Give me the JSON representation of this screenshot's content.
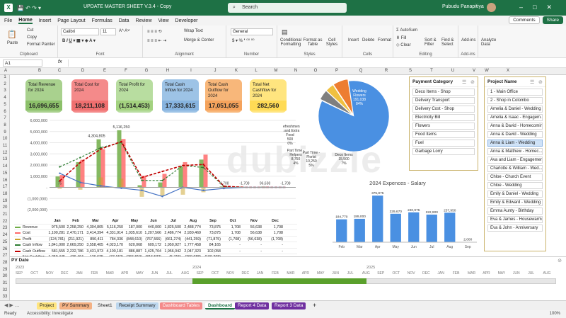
{
  "window": {
    "title": "UPDATE MASTER SHEET V.3.4 - Copy",
    "search": "Search",
    "user": "Pubudu Panapitiya",
    "app_letter": "X"
  },
  "menu": {
    "items": [
      "File",
      "Home",
      "Insert",
      "Page Layout",
      "Formulas",
      "Data",
      "Review",
      "View",
      "Developer"
    ],
    "active": "Home",
    "comments": "Comments",
    "share": "Share"
  },
  "ribbon": {
    "paste": "Paste",
    "cut": "Cut",
    "copy": "Copy",
    "format_painter": "Format Painter",
    "clipboard": "Clipboard",
    "font_name": "Calibri",
    "font_size": "11",
    "font": "Font",
    "wrap": "Wrap Text",
    "merge": "Merge & Center",
    "alignment": "Alignment",
    "number_format": "General",
    "number": "Number",
    "cond": "Conditional Formatting",
    "fmt_table": "Format as Table",
    "cell_styles": "Cell Styles",
    "styles": "Styles",
    "insert": "Insert",
    "delete": "Delete",
    "format": "Format",
    "cells": "Cells",
    "autosum": "AutoSum",
    "fill": "Fill",
    "clear": "Clear",
    "sort": "Sort & Filter",
    "find": "Find & Select",
    "editing": "Editing",
    "addins": "Add-ins",
    "addins_g": "Add-ins",
    "analyze": "Analyze Data"
  },
  "formula": {
    "cell": "A1",
    "fx": "fx"
  },
  "columns": [
    "A",
    "B",
    "C",
    "D",
    "E",
    "F",
    "G",
    "H",
    "I",
    "J",
    "K",
    "L",
    "M",
    "N",
    "O",
    "P",
    "Q",
    "R",
    "S",
    "T",
    "U",
    "V",
    "W",
    "X"
  ],
  "rows": [
    "1",
    "2",
    "3",
    "4",
    "5",
    "6",
    "7",
    "8",
    "9",
    "10",
    "11",
    "12",
    "13",
    "14",
    "15",
    "16",
    "17",
    "18",
    "19",
    "20",
    "21",
    "22",
    "23",
    "24",
    "25",
    "26",
    "27",
    "28",
    "29",
    "30",
    "31",
    "32",
    "33",
    "34"
  ],
  "cards": [
    {
      "title": "Total Revenue for 2024",
      "value": "16,696,655",
      "color": "#a9d18e",
      "vcolor": "#8cc06a"
    },
    {
      "title": "Total Cost for 2024",
      "value": "18,211,108",
      "color": "#f48a8a",
      "vcolor": "#ef6f6f"
    },
    {
      "title": "Total Profit for 2024",
      "value": "(1,514,453)",
      "color": "#b8dda0",
      "vcolor": "#a3d27f"
    },
    {
      "title": "Total Cash Inflow for 2024",
      "value": "17,333,615",
      "color": "#9dc3e6",
      "vcolor": "#86b3df"
    },
    {
      "title": "Total Cash Outflow for 2024",
      "value": "17,051,055",
      "color": "#f8b77a",
      "vcolor": "#f5a35c"
    },
    {
      "title": "Total Net Cashflow for 2024",
      "value": "282,560",
      "color": "#ffe57f",
      "vcolor": "#ffdb55"
    }
  ],
  "payment_slicer": {
    "title": "Payment Category",
    "items": [
      "Deco Items - Shop",
      "Delivery Transport",
      "Delivery Cost - Shop",
      "Electricity Bill",
      "Flowers",
      "Food Items",
      "Fuel",
      "Garbage Lorry"
    ]
  },
  "project_slicer": {
    "title": "Project Name",
    "items": [
      "1 - Main Office",
      "2 - Shop in Colombo",
      "Amelia & Daniel - Wedding",
      "Amelia & Isaac - Engagem...",
      "Anna & David - Homecoming",
      "Anna & David - Wedding",
      "Anna & Liam - Wedding",
      "Anna & Matthew - Homec...",
      "Ava and Liam - Engagement",
      "Charlotte & William - Wed...",
      "Chloe - Church Event",
      "Chloe - Wedding",
      "Emily & Daniel - Wedding",
      "Emily & Edward - Wedding",
      "Emma Aunty - Birthday",
      "Eva & James - Housewarm...",
      "Eva & John - Anniversary"
    ],
    "selected": "Anna & Liam - Wedding"
  },
  "chart_data": [
    {
      "type": "bar",
      "categories": [
        "Jan",
        "Feb",
        "Mar",
        "Apr",
        "May",
        "Jun",
        "Jul",
        "Aug",
        "Sep",
        "Oct",
        "Nov",
        "Dec"
      ],
      "series": [
        {
          "name": "Revenue",
          "values": [
            975500,
            2258250,
            4304805,
            5116250,
            187000,
            440000,
            1825500,
            2488774,
            73875,
            1708,
            56638,
            1708
          ],
          "color": "#70ad47"
        },
        {
          "name": "Cost",
          "values": [
            1100281,
            2470171,
            3414394,
            4331914,
            1035610,
            1207566,
            2256962,
            2930469,
            73875,
            1708,
            56638,
            1708
          ],
          "color": "#ff6b6b"
        },
        {
          "name": "Profit",
          "values": [
            -124781,
            -211921,
            890411,
            784336,
            -848610,
            -767566,
            -661274,
            -441259,
            -71875,
            -1708,
            -56638,
            -1708
          ],
          "color": "#c9a227"
        },
        {
          "name": "Cash Inflow",
          "values": [
            1841000,
            2669250,
            3558405,
            4023170,
            620068,
            609172,
            1950927,
            1777458,
            84165,
            0,
            0,
            0
          ],
          "color": "#2e7d32"
        },
        {
          "name": "Cash Outflow",
          "values": [
            581555,
            2232786,
            3431973,
            4100181,
            886887,
            1425704,
            1956042,
            2047323,
            102058,
            0,
            0,
            0
          ],
          "color": "#c00000"
        },
        {
          "name": "Net Cashflow",
          "values": [
            1259445,
            436464,
            126625,
            -77152,
            -266819,
            -816532,
            -5715,
            -269688,
            -100268,
            0,
            0,
            0
          ],
          "color": "#4472c4"
        }
      ],
      "ylim": [
        -2000000,
        6000000
      ],
      "yticks": [
        "6,000,000",
        "5,000,000",
        "4,000,000",
        "3,000,000",
        "2,000,000",
        "1,000,000",
        "-",
        "(1,000,000)",
        "(2,000,000)"
      ],
      "labels_peak": [
        "4,304,805",
        "5,116,250"
      ],
      "labels_small": [
        "75",
        "-1,708",
        "-1,708",
        "96,638",
        "-1,708"
      ],
      "table": [
        {
          "name": "Revenue",
          "cells": [
            "975,500",
            "2,258,250",
            "4,304,805",
            "5,116,250",
            "187,000",
            "440,000",
            "1,825,500",
            "2,488,774",
            "73,875",
            "1,708",
            "56,638",
            "1,708"
          ]
        },
        {
          "name": "Cost",
          "cells": [
            "1,100,281",
            "2,470,171",
            "3,414,394",
            "4,331,914",
            "1,035,610",
            "1,207,566",
            "2,486,774",
            "2,930,469",
            "73,875",
            "1,708",
            "56,638",
            "1,708"
          ]
        },
        {
          "name": "Profit",
          "cells": [
            "(124,781)",
            "(211,921)",
            "890,411",
            "784,336",
            "(848,610)",
            "(767,566)",
            "(661,274)",
            "(441,259)",
            "(71,875)",
            "(1,708)",
            "(56,638)",
            "(1,708)"
          ]
        },
        {
          "name": "Cash Inflow",
          "cells": [
            "1,841,000",
            "2,669,250",
            "3,558,405",
            "4,023,170",
            "620,068",
            "609,172",
            "1,950,927",
            "1,777,458",
            "84,165",
            "-",
            "-",
            "-"
          ]
        },
        {
          "name": "Cash Outflow",
          "cells": [
            "581,555",
            "2,232,786",
            "3,431,973",
            "4,100,181",
            "886,887",
            "1,425,704",
            "1,956,042",
            "2,047,323",
            "102,058",
            "-",
            "-",
            "-"
          ]
        },
        {
          "name": "Net Cashflow",
          "cells": [
            "1,259,445",
            "436,464",
            "126,625",
            "(77,152)",
            "(266,819)",
            "(816,532)",
            "(5,715)",
            "(269,688)",
            "(100,268)",
            "-",
            "-",
            "-"
          ]
        }
      ]
    },
    {
      "type": "pie",
      "slices": [
        {
          "name": "Wedding Flowers",
          "label": "Wedding Flowers",
          "value": 191038,
          "pct": "84%",
          "vtxt": "191,038",
          "color": "#4a90e2"
        },
        {
          "name": "Refreshments and Extra Food",
          "label": "Refreshmen ts and Extra Food",
          "value": 500,
          "pct": "0%",
          "vtxt": "500",
          "color": "#a9c7e8"
        },
        {
          "name": "Part Time - Florist",
          "label": "Part Time - Florist",
          "value": 10250,
          "pct": "5%",
          "vtxt": "10,250",
          "color": "#7f7f7f"
        },
        {
          "name": "Part Time - Helpers",
          "label": "Part Time - Helpers",
          "value": 8750,
          "pct": "4%",
          "vtxt": "8,750",
          "color": "#f0c040"
        },
        {
          "name": "Deco Items",
          "label": "Deco Items",
          "value": 15500,
          "pct": "7%",
          "vtxt": "15,500",
          "color": "#ed7d31"
        }
      ]
    },
    {
      "type": "bar",
      "title": "2024 Expences - Salary",
      "categories": [
        "Feb",
        "Mar",
        "Apr",
        "May",
        "Jun",
        "Jul",
        "Aug",
        "Sep"
      ],
      "values": [
        184770,
        189000,
        375875,
        229670,
        240975,
        222900,
        237950,
        2000
      ],
      "value_labels": [
        "184,770",
        "189,000",
        "375,875",
        "229,670",
        "240,975",
        "222,900",
        "237,950",
        "2,000"
      ],
      "color": "#4a90e2"
    }
  ],
  "timeline": {
    "title": "PV Date",
    "year_left": "2023",
    "year_mid": "2024",
    "year_right": "2025",
    "months": [
      "SEP",
      "OCT",
      "NOV",
      "DEC",
      "JAN",
      "FEB",
      "MAR",
      "APR",
      "MAY",
      "JUN",
      "JUL",
      "AUG",
      "SEP",
      "OCT",
      "NOV",
      "DEC",
      "JAN",
      "FEB",
      "MAR",
      "APR",
      "MAY",
      "JUN",
      "JUL",
      "AUG",
      "SEP",
      "OCT",
      "NOV",
      "DEC",
      "JAN",
      "FEB",
      "MAR",
      "APR",
      "MAY",
      "JUN",
      "JUL",
      "AUG"
    ]
  },
  "tabs": [
    {
      "name": "Project",
      "bg": "#ffe57f",
      "fg": "#222"
    },
    {
      "name": "PV Summary",
      "bg": "#f4b183",
      "fg": "#222"
    },
    {
      "name": "Sheet1",
      "bg": "#f0f0f0",
      "fg": "#222"
    },
    {
      "name": "Receipt Summary",
      "bg": "#bdd7ee",
      "fg": "#222"
    },
    {
      "name": "Dashboard Tables",
      "bg": "#f48a8a",
      "fg": "#fff"
    },
    {
      "name": "Dashboard",
      "bg": "#ffffff",
      "fg": "#1e7145"
    },
    {
      "name": "Report 4 Data",
      "bg": "#7030a0",
      "fg": "#fff"
    },
    {
      "name": "Report 3 Data",
      "bg": "#7030a0",
      "fg": "#fff"
    }
  ],
  "status": {
    "ready": "Ready",
    "accessibility": "Accessibility: Investigate",
    "zoom": "100%"
  },
  "watermark": "dubizzle"
}
